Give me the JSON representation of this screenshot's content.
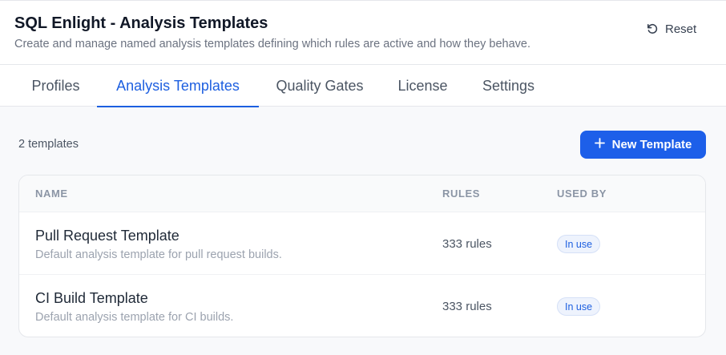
{
  "header": {
    "title": "SQL Enlight - Analysis Templates",
    "subtitle": "Create and manage named analysis templates defining which rules are active and how they behave.",
    "reset_label": "Reset",
    "reset_icon": "reset-icon"
  },
  "tabs": [
    {
      "label": "Profiles",
      "active": false
    },
    {
      "label": "Analysis Templates",
      "active": true
    },
    {
      "label": "Quality Gates",
      "active": false
    },
    {
      "label": "License",
      "active": false
    },
    {
      "label": "Settings",
      "active": false
    }
  ],
  "toolbar": {
    "count_text": "2 templates",
    "new_label": "New Template",
    "new_icon": "plus-icon"
  },
  "table": {
    "columns": {
      "name": "NAME",
      "rules": "RULES",
      "used_by": "USED BY"
    },
    "rows": [
      {
        "name": "Pull Request Template",
        "description": "Default analysis template for pull request builds.",
        "rules": "333 rules",
        "used_by": "In use"
      },
      {
        "name": "CI Build Template",
        "description": "Default analysis template for CI builds.",
        "rules": "333 rules",
        "used_by": "In use"
      }
    ]
  },
  "colors": {
    "accent": "#1d5fe9",
    "badge_bg": "#eef3fd",
    "badge_text": "#1d5fe0"
  }
}
